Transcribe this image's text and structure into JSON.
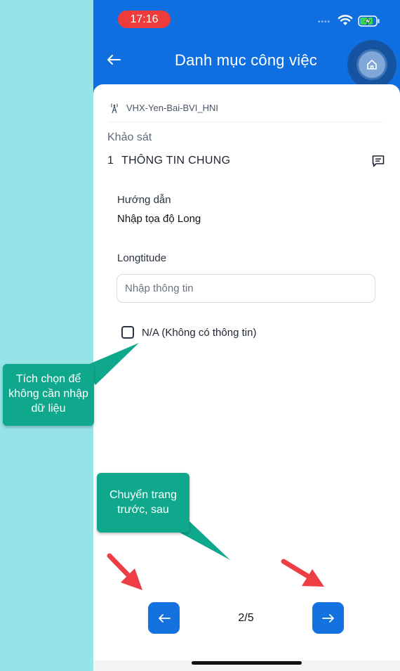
{
  "status_bar": {
    "time": "17:16",
    "dots": "••••"
  },
  "header": {
    "title": "Danh mục công việc"
  },
  "card": {
    "site_name": "VHX-Yen-Bai-BVI_HNI",
    "section_label": "Khảo sát",
    "section_number": "1",
    "section_name": "THÔNG TIN CHUNG",
    "guide_label": "Hướng dẫn",
    "guide_text": "Nhập tọa độ Long",
    "field_label": "Longtitude",
    "field_placeholder": "Nhập thông tin",
    "field_value": "",
    "na_label": "N/A (Không có thông tin)",
    "na_checked": false
  },
  "pagination": {
    "current": 2,
    "total": 5,
    "text": "2/5"
  },
  "annotations": {
    "checkbox_note": "Tích chọn để không cần nhập dữ liệu",
    "nav_note": "Chuyển trang trước, sau"
  },
  "colors": {
    "header_blue": "#0f6fe0",
    "button_blue": "#1472e0",
    "callout_green": "#10a88d",
    "arrow_red": "#ee3e45",
    "side_panel": "#97e4e8",
    "status_time_red": "#ee3b3b"
  },
  "icons": {
    "back": "arrow-left-icon",
    "home": "home-icon",
    "site": "tower-icon",
    "comment": "comment-icon",
    "prev": "arrow-left-icon",
    "next": "arrow-right-icon"
  }
}
